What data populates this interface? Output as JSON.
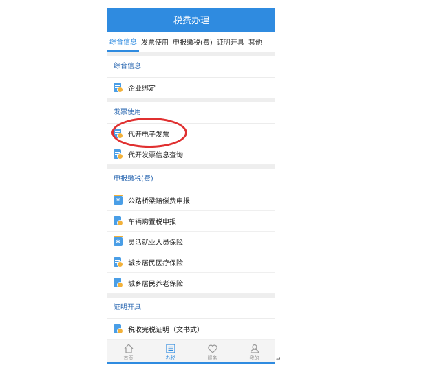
{
  "header": {
    "title": "税费办理"
  },
  "tabs": [
    {
      "label": "综合信息",
      "active": true
    },
    {
      "label": "发票使用"
    },
    {
      "label": "申报缴税(费)"
    },
    {
      "label": "证明开具"
    },
    {
      "label": "其他"
    }
  ],
  "sections": [
    {
      "title": "综合信息",
      "items": [
        "企业绑定"
      ]
    },
    {
      "title": "发票使用",
      "items": [
        "代开电子发票",
        "代开发票信息查询"
      ]
    },
    {
      "title": "申报缴税(费)",
      "items": [
        "公路桥梁赔偿费申报",
        "车辆购置税申报",
        "灵活就业人员保险",
        "城乡居民医疗保险",
        "城乡居民养老保险"
      ]
    },
    {
      "title": "证明开具",
      "items": [
        "税收完税证明（文书式）"
      ]
    }
  ],
  "icons": {
    "coin_symbol": "¥",
    "asterisk_symbol": "✱"
  },
  "bottom_nav": [
    {
      "label": "首页",
      "icon": "home-icon"
    },
    {
      "label": "办税",
      "icon": "list-icon",
      "active": true
    },
    {
      "label": "服务",
      "icon": "heart-icon"
    },
    {
      "label": "我的",
      "icon": "user-icon"
    }
  ],
  "colors": {
    "primary": "#2f8be0",
    "highlight_ring": "#e03030",
    "badge": "#f2b13a"
  },
  "return_mark": "↵"
}
